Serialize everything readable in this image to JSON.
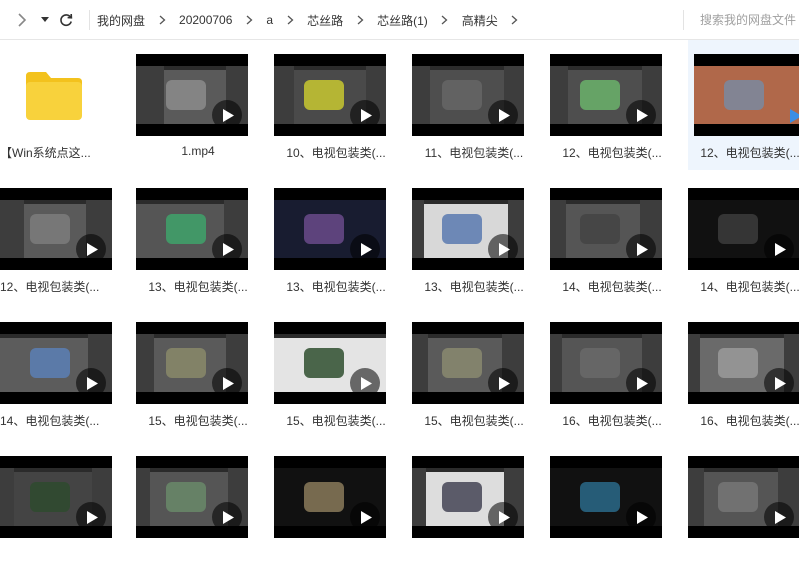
{
  "toolbar": {
    "back_icon": "chevron-right-icon",
    "dropdown_icon": "caret-down-icon",
    "refresh_icon": "refresh-icon"
  },
  "breadcrumb": [
    "我的网盘",
    "20200706",
    "a",
    "芯丝路",
    "芯丝路(1)",
    "高精尖"
  ],
  "search": {
    "placeholder": "搜索我的网盘文件"
  },
  "files": [
    {
      "name": "【Win系统点这...",
      "type": "folder"
    },
    {
      "name": "1.mp4",
      "type": "video"
    },
    {
      "name": "10、电视包装类(...",
      "type": "video"
    },
    {
      "name": "11、电视包装类(...",
      "type": "video"
    },
    {
      "name": "12、电视包装类(...",
      "type": "video"
    },
    {
      "name": "12、电视包装类(...",
      "type": "video",
      "selected": true
    },
    {
      "name": "12、电视包装类(...",
      "type": "video"
    },
    {
      "name": "13、电视包装类(...",
      "type": "video"
    },
    {
      "name": "13、电视包装类(...",
      "type": "video"
    },
    {
      "name": "13、电视包装类(...",
      "type": "video"
    },
    {
      "name": "14、电视包装类(...",
      "type": "video"
    },
    {
      "name": "14、电视包装类(...",
      "type": "video"
    },
    {
      "name": "14、电视包装类(...",
      "type": "video"
    },
    {
      "name": "15、电视包装类(...",
      "type": "video"
    },
    {
      "name": "15、电视包装类(...",
      "type": "video"
    },
    {
      "name": "15、电视包装类(...",
      "type": "video"
    },
    {
      "name": "16、电视包装类(...",
      "type": "video"
    },
    {
      "name": "16、电视包装类(...",
      "type": "video"
    },
    {
      "name": "",
      "type": "video"
    },
    {
      "name": "",
      "type": "video"
    },
    {
      "name": "",
      "type": "video"
    },
    {
      "name": "",
      "type": "video"
    },
    {
      "name": "",
      "type": "video"
    },
    {
      "name": "",
      "type": "video"
    }
  ],
  "colors": {
    "folder": "#f8d23c",
    "folder_tab": "#f3c21d",
    "selected_bg": "#eef5fd",
    "accent": "#3a8ee6"
  }
}
